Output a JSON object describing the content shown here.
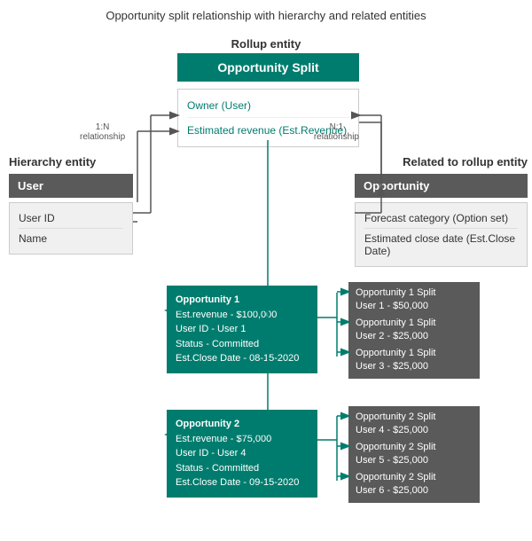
{
  "title": "Opportunity split relationship with hierarchy and related entities",
  "rollupLabel": "Rollup entity",
  "oppSplitBox": "Opportunity Split",
  "fieldsBox": {
    "field1": "Owner (User)",
    "field2": "Estimated revenue (Est.Revenue)"
  },
  "hierarchyLabel": "Hierarchy entity",
  "userBoxHeader": "User",
  "userFields": [
    "User ID",
    "Name"
  ],
  "relatedLabel": "Related to rollup entity",
  "oppBoxHeader": "Opportunity",
  "oppFields": [
    "Forecast category (Option set)",
    "Estimated close date (Est.Close Date)"
  ],
  "rel1N": "1:N\nrelationship",
  "relN1": "N:1\nrelationship",
  "opp1": {
    "line1": "Opportunity 1",
    "line2": "Est.revenue - $100,000",
    "line3": "User ID - User 1",
    "line4": "Status - Committed",
    "line5": "Est.Close Date - 08-15-2020"
  },
  "opp2": {
    "line1": "Opportunity 2",
    "line2": "Est.revenue - $75,000",
    "line3": "User ID - User 4",
    "line4": "Status - Committed",
    "line5": "Est.Close Date - 09-15-2020"
  },
  "splits1": [
    {
      "line1": "Opportunity 1 Split",
      "line2": "User 1 - $50,000"
    },
    {
      "line1": "Opportunity 1 Split",
      "line2": "User 2 - $25,000"
    },
    {
      "line1": "Opportunity 1 Split",
      "line2": "User 3 - $25,000"
    }
  ],
  "splits2": [
    {
      "line1": "Opportunity 2 Split",
      "line2": "User 4 - $25,000"
    },
    {
      "line1": "Opportunity 2 Split",
      "line2": "User 5 - $25,000"
    },
    {
      "line1": "Opportunity 2 Split",
      "line2": "User 6 - $25,000"
    }
  ]
}
